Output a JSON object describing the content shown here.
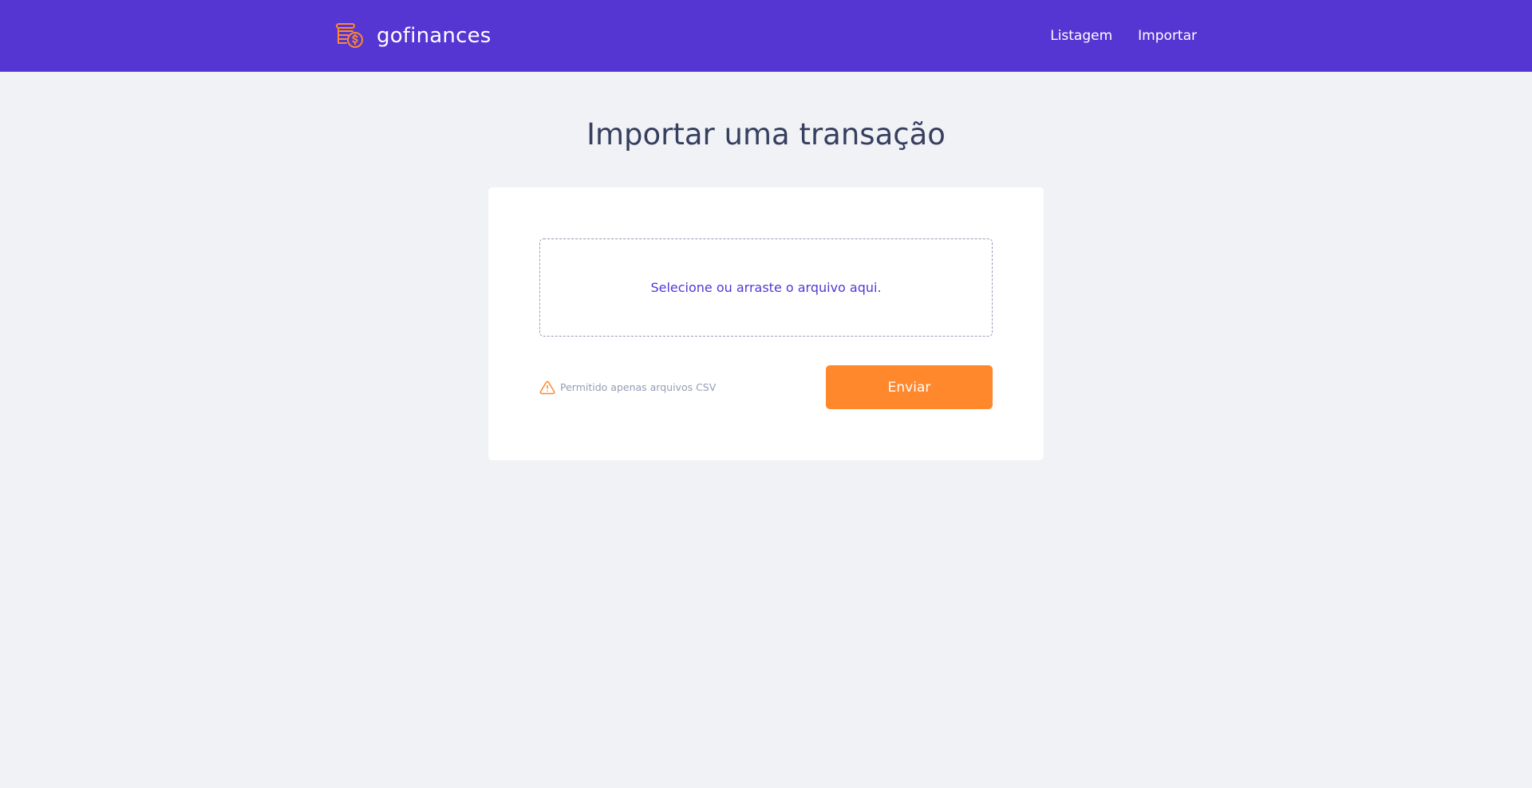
{
  "colors": {
    "header_bg": "#5636D3",
    "page_bg": "#F0F2F5",
    "accent_orange": "#FF872C",
    "title_text": "#363F5F",
    "muted_text": "#969CB3",
    "dropzone_text": "#5636D3"
  },
  "header": {
    "brand": {
      "icon": "coins-dollar-icon",
      "name": "gofinances"
    },
    "nav": [
      {
        "label": "Listagem"
      },
      {
        "label": "Importar"
      }
    ]
  },
  "main": {
    "title": "Importar uma transação",
    "upload": {
      "dropzone_text": "Selecione ou arraste o arquivo aqui.",
      "hint_icon": "alert-triangle-icon",
      "hint_text": "Permitido apenas arquivos CSV",
      "submit_label": "Enviar"
    }
  }
}
